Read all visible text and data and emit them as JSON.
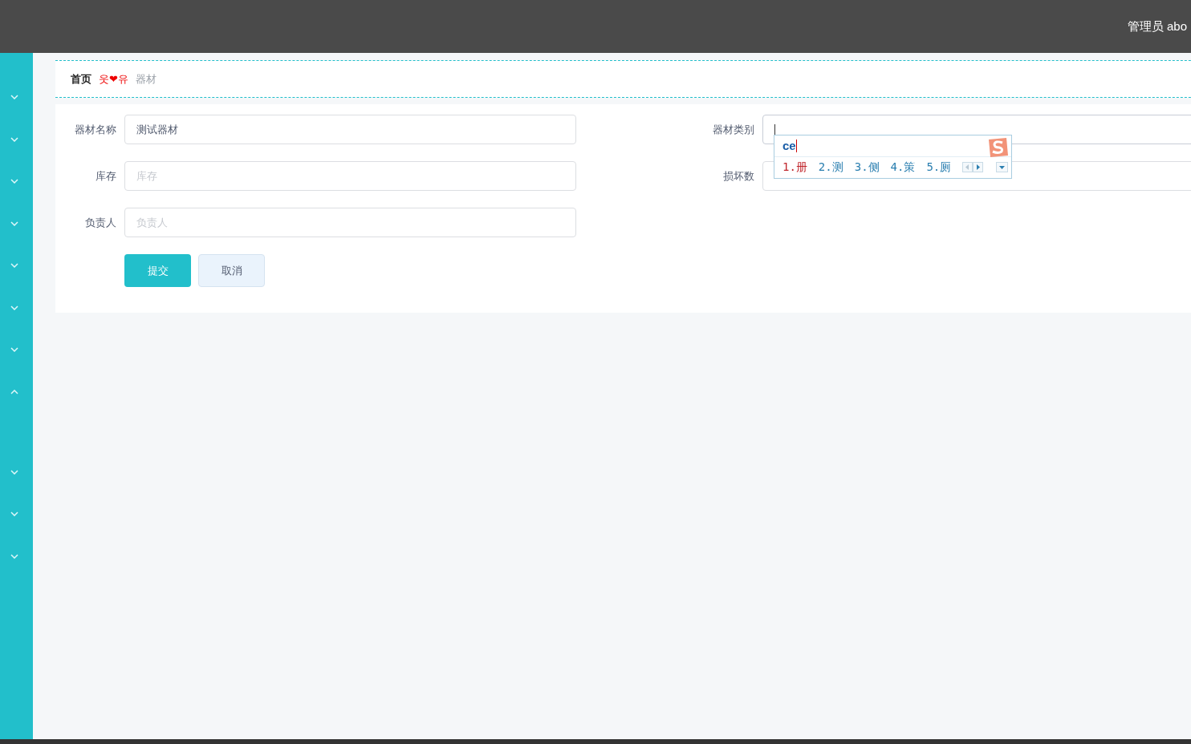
{
  "header": {
    "user": "管理员 abo"
  },
  "sidebar": {
    "items": [
      {
        "expanded": false
      },
      {
        "expanded": false
      },
      {
        "expanded": false
      },
      {
        "expanded": false
      },
      {
        "expanded": false
      },
      {
        "expanded": false
      },
      {
        "expanded": false
      },
      {
        "expanded": true
      },
      {
        "expanded": false
      },
      {
        "expanded": false
      },
      {
        "expanded": false
      }
    ]
  },
  "breadcrumb": {
    "home": "首页",
    "separator": "웃❤유",
    "current": "器材"
  },
  "form": {
    "fields": [
      {
        "label": "器材名称",
        "value": "测试器材"
      },
      {
        "label": "器材类别",
        "focused": true
      },
      {
        "label": "库存",
        "placeholder": "库存"
      },
      {
        "label": "损坏数"
      },
      {
        "label": "负责人",
        "placeholder": "负责人"
      }
    ],
    "buttons": [
      {
        "kind": "primary",
        "label": "提交"
      },
      {
        "kind": "secondary",
        "label": "取消"
      }
    ]
  },
  "ime": {
    "composition": "ce",
    "candidates": [
      {
        "label": "1.册",
        "selected": true
      },
      {
        "label": "2.测",
        "selected": false
      },
      {
        "label": "3.侧",
        "selected": false
      },
      {
        "label": "4.策",
        "selected": false
      },
      {
        "label": "5.厕",
        "selected": false
      }
    ]
  }
}
